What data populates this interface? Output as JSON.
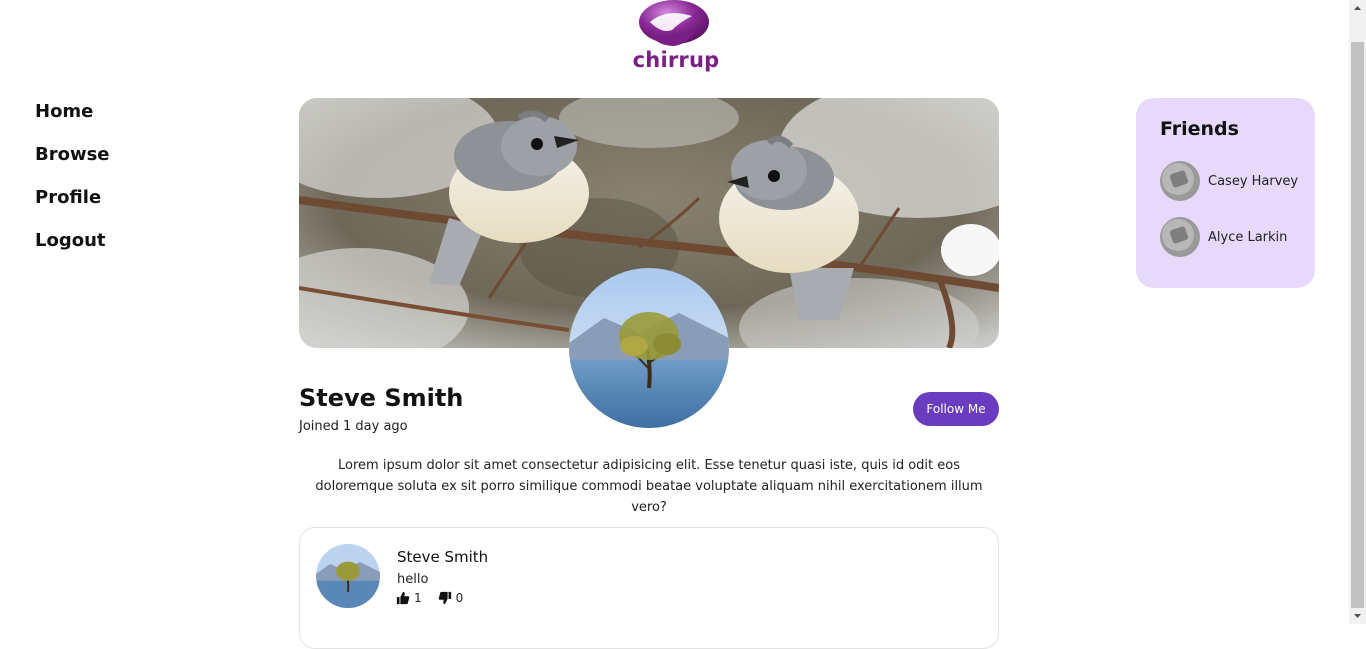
{
  "brand": {
    "name": "chirrup",
    "logo_icon": "bird-logo-icon",
    "color": "#7b1f86"
  },
  "nav": [
    {
      "label": "Home"
    },
    {
      "label": "Browse"
    },
    {
      "label": "Profile"
    },
    {
      "label": "Logout"
    }
  ],
  "profile": {
    "banner_image": "two-birds-on-branch-image",
    "avatar_image": "lone-tree-in-lake-image",
    "name": "Steve Smith",
    "joined": "Joined 1 day ago",
    "follow_label": "Follow Me",
    "bio": "Lorem ipsum dolor sit amet consectetur adipisicing elit. Esse tenetur quasi iste, quis id odit eos doloremque soluta ex sit porro similique commodi beatae voluptate aliquam nihil exercitationem illum vero?",
    "accent": "#6a3cc0"
  },
  "posts": [
    {
      "author": "Steve Smith",
      "text": "hello",
      "likes": "1",
      "dislikes": "0",
      "like_icon": "thumbs-up-icon",
      "dislike_icon": "thumbs-down-icon"
    }
  ],
  "friends": {
    "title": "Friends",
    "panel_color": "#e6d9fb",
    "items": [
      {
        "name": "Casey Harvey"
      },
      {
        "name": "Alyce Larkin"
      }
    ]
  }
}
